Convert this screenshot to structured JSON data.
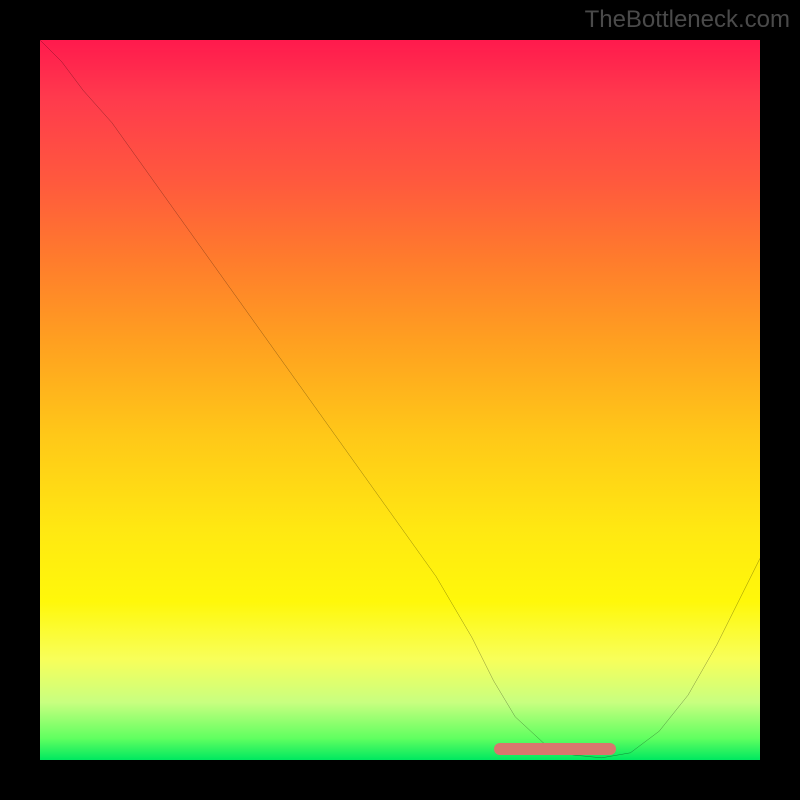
{
  "watermark": "TheBottleneck.com",
  "chart_data": {
    "type": "line",
    "title": "",
    "xlabel": "",
    "ylabel": "",
    "xlim": [
      0,
      100
    ],
    "ylim": [
      0,
      100
    ],
    "grid": false,
    "axes_shown": false,
    "legend": false,
    "background": "vertical gradient (red top → green bottom) encoding cost/severity by vertical position",
    "x": [
      0,
      3,
      6,
      10,
      15,
      20,
      25,
      30,
      35,
      40,
      45,
      50,
      55,
      60,
      63,
      66,
      70,
      74,
      78,
      82,
      86,
      90,
      94,
      97,
      100
    ],
    "values": [
      100,
      97,
      93,
      88.5,
      81.5,
      74.5,
      67.5,
      60.5,
      53.5,
      46.5,
      39.5,
      32.5,
      25.5,
      17,
      11,
      6,
      2.3,
      0.7,
      0.3,
      1,
      4,
      9,
      16,
      22,
      28
    ],
    "series": [
      {
        "name": "curve",
        "x_ref": "x",
        "values_ref": "values",
        "stroke": "#000000",
        "weight": 1.4
      }
    ],
    "highlight_segment": {
      "note": "bold coral segment marking the sweet-spot range near the minimum",
      "color": "#d8766e",
      "x_start": 63,
      "x_end": 80,
      "y_approx": 1.5
    }
  }
}
